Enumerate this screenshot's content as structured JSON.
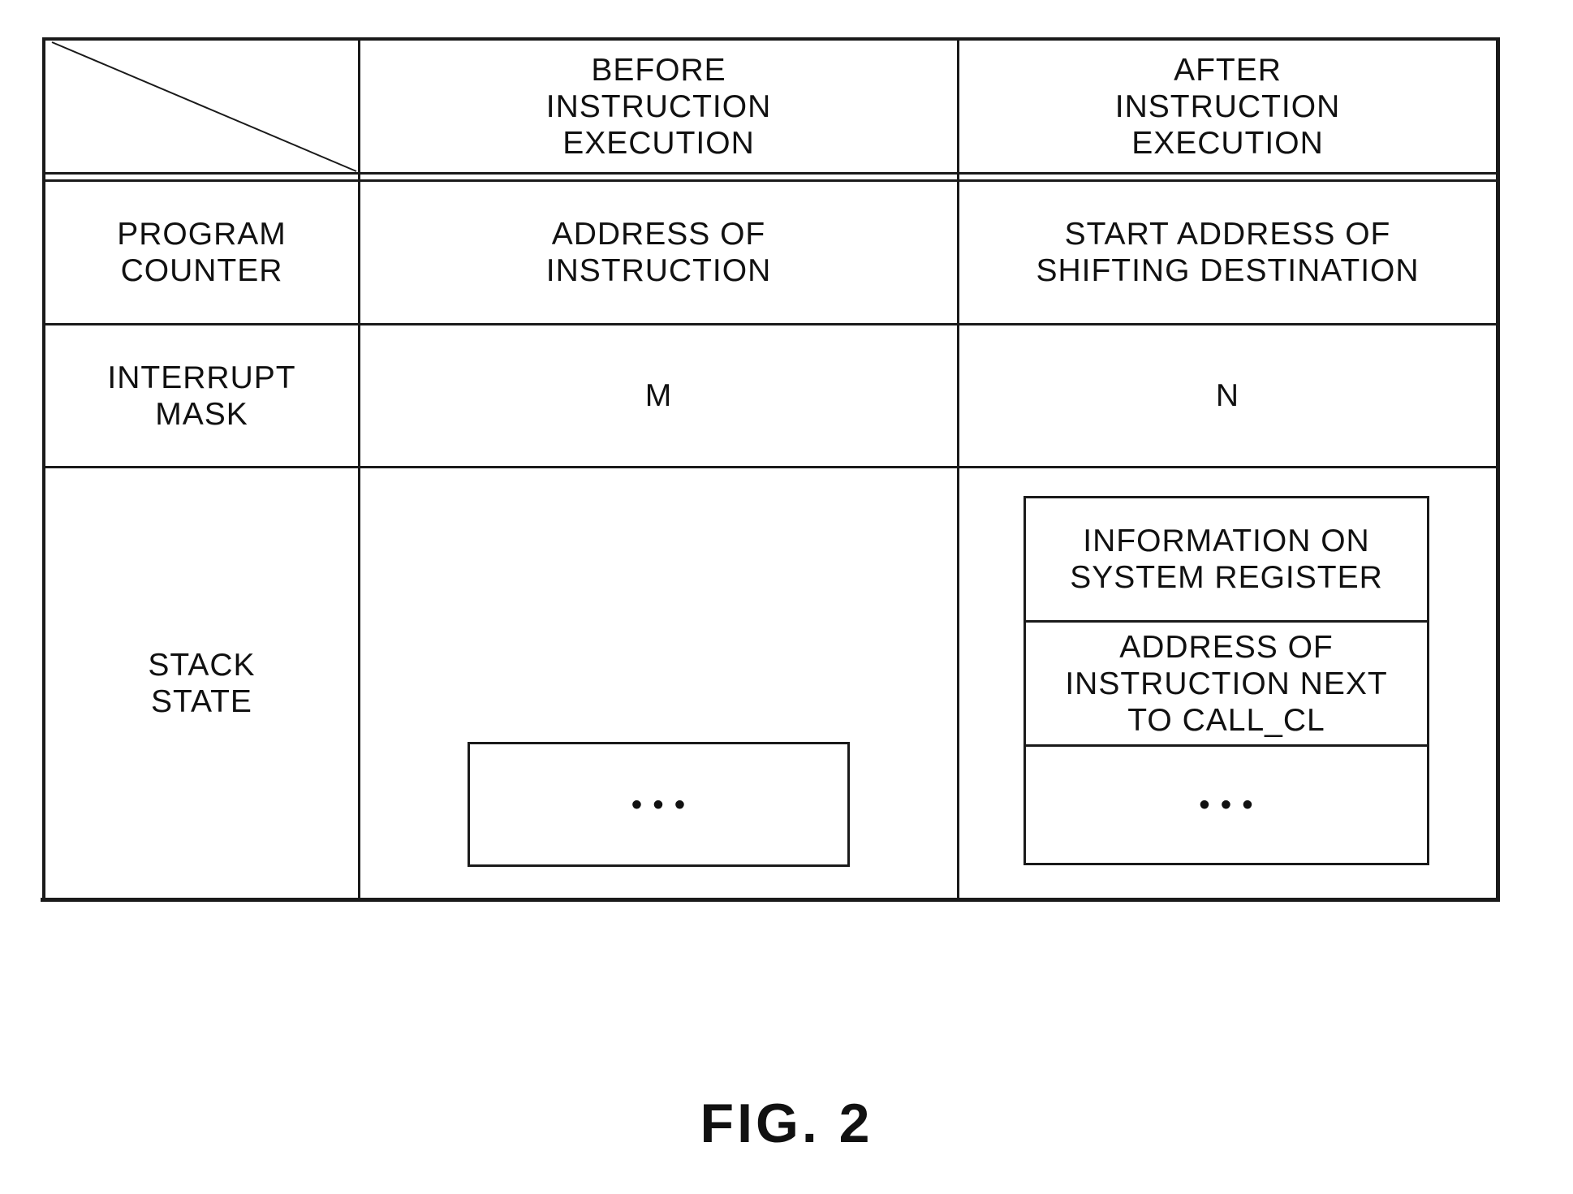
{
  "figure_label": "FIG. 2",
  "table": {
    "columns": [
      "",
      "BEFORE\nINSTRUCTION\nEXECUTION",
      "AFTER\nINSTRUCTION\nEXECUTION"
    ],
    "rows": [
      {
        "label": "PROGRAM\nCOUNTER",
        "before": "ADDRESS OF\nINSTRUCTION",
        "after": "START ADDRESS OF\nSHIFTING DESTINATION"
      },
      {
        "label": "INTERRUPT\nMASK",
        "before": "M",
        "after": "N"
      },
      {
        "label": "STACK\nSTATE",
        "before": null,
        "after": null
      }
    ]
  },
  "stack_before": [
    "• • •"
  ],
  "stack_after": [
    "INFORMATION ON\nSYSTEM REGISTER",
    "ADDRESS OF\nINSTRUCTION NEXT\nTO CALL_CL",
    "• • •"
  ]
}
